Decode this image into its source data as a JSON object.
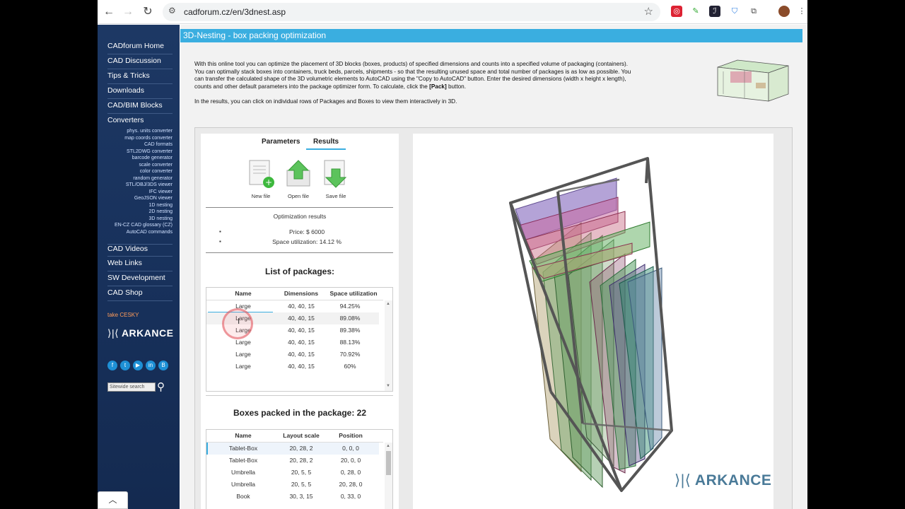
{
  "browser": {
    "url": "cadforum.cz/en/3dnest.asp"
  },
  "sidebar": {
    "items": [
      {
        "label": "CADforum Home"
      },
      {
        "label": "CAD Discussion"
      },
      {
        "label": "Tips & Tricks"
      },
      {
        "label": "Downloads"
      },
      {
        "label": "CAD/BIM Blocks"
      },
      {
        "label": "Converters"
      }
    ],
    "subitems": [
      "phys. units converter",
      "map coords converter",
      "CAD formats",
      "STL2DWG converter",
      "barcode generator",
      "scale converter",
      "color converter",
      "random generator",
      "STL/OBJ/3DS viewer",
      "IFC viewer",
      "GeoJSON viewer",
      "1D nesting",
      "2D nesting",
      "3D nesting",
      "EN-CZ CAD glossary (CZ)",
      "AutoCAD commands"
    ],
    "items2": [
      {
        "label": "CAD Videos"
      },
      {
        "label": "Web Links"
      },
      {
        "label": "SW Development"
      },
      {
        "label": "CAD Shop"
      }
    ],
    "take_cesky": "take CESKY",
    "logo": "ARKANCE",
    "search_placeholder": "Sitewide search"
  },
  "page": {
    "title": "3D-Nesting - box packing optimization",
    "intro_lines": [
      "With this online tool you can optimize the placement of 3D blocks (boxes, products) of specified dimensions and counts into a specified volume of packaging (containers).",
      "You can optimally stack boxes into containers, truck beds, parcels, shipments - so that the resulting unused space and total number of packages is as low as possible. You",
      "can transfer the calculated shape of the 3D volumetric elements to AutoCAD using the \"Copy to AutoCAD\" button. Enter the desired dimensions (width x height x length),"
    ],
    "intro_last_pre": "counts and other default parameters into the package optimizer form. To calculate, click the",
    "intro_last_bold": "[Pack]",
    "intro_last_post": "button.",
    "intro2": "In the results, you can click on individual rows of Packages and Boxes to view them interactively in 3D."
  },
  "tabs": {
    "parameters": "Parameters",
    "results": "Results"
  },
  "toolbar": {
    "new_file": "New file",
    "open_file": "Open file",
    "save_file": "Save file"
  },
  "results": {
    "title": "Optimization results",
    "price": "Price: $ 6000",
    "space": "Space utilization: 14.12 %"
  },
  "packages": {
    "title": "List of packages:",
    "columns": [
      "Name",
      "Dimensions",
      "Space utilization"
    ],
    "rows": [
      [
        "Large",
        "40, 40, 15",
        "94.25%"
      ],
      [
        "Large",
        "40, 40, 15",
        "89.08%"
      ],
      [
        "Large",
        "40, 40, 15",
        "89.38%"
      ],
      [
        "Large",
        "40, 40, 15",
        "88.13%"
      ],
      [
        "Large",
        "40, 40, 15",
        "70.92%"
      ],
      [
        "Large",
        "40, 40, 15",
        "60%"
      ]
    ]
  },
  "boxes": {
    "title": "Boxes packed in the package: 22",
    "columns": [
      "Name",
      "Layout scale",
      "Position"
    ],
    "rows": [
      [
        "Tablet-Box",
        "20, 28, 2",
        "0, 0, 0"
      ],
      [
        "Tablet-Box",
        "20, 28, 2",
        "20, 0, 0"
      ],
      [
        "Umbrella",
        "20, 5, 5",
        "0, 28, 0"
      ],
      [
        "Umbrella",
        "20, 5, 5",
        "20, 28, 0"
      ],
      [
        "Book",
        "30, 3, 15",
        "0, 33, 0"
      ]
    ]
  },
  "viewer": {
    "watermark": "ARKANCE"
  },
  "colors": {
    "accent": "#3aaee0",
    "sidebar": "#1d3864"
  }
}
